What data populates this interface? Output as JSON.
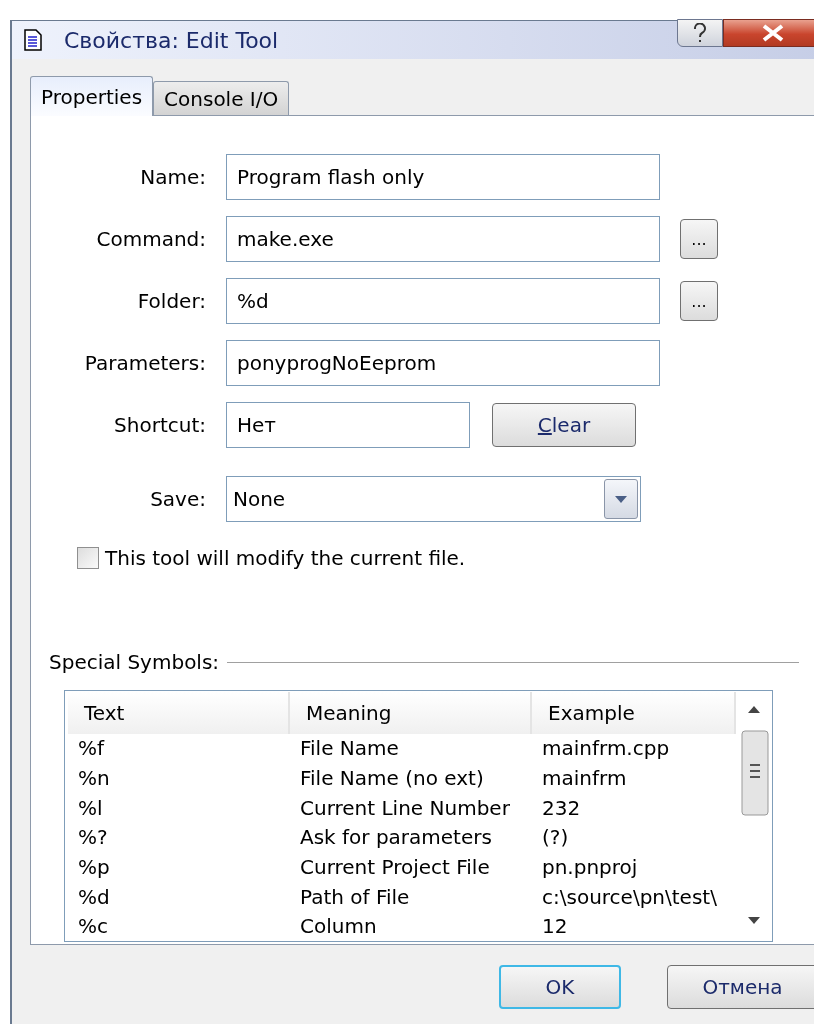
{
  "window": {
    "title": "Свойства: Edit Tool"
  },
  "tabs": [
    {
      "label": "Properties",
      "selected": true
    },
    {
      "label": "Console I/O",
      "selected": false
    }
  ],
  "fields": [
    {
      "kind": "text",
      "label": "Name:",
      "value": "Program flash only"
    },
    {
      "kind": "browse",
      "label": "Command:",
      "value": "make.exe",
      "button": "..."
    },
    {
      "kind": "browse",
      "label": "Folder:",
      "value": "%d",
      "button": "..."
    },
    {
      "kind": "text",
      "label": "Parameters:",
      "value": "ponyprogNoEeprom"
    },
    {
      "kind": "shortcut",
      "label": "Shortcut:",
      "value": "Нет",
      "button": "Clear"
    },
    {
      "kind": "select",
      "label": "Save:",
      "value": "None"
    }
  ],
  "modify_checkbox": {
    "label": "This tool will modify the current file.",
    "checked": false
  },
  "special_symbols": {
    "title": "Special Symbols:",
    "columns": [
      "Text",
      "Meaning",
      "Example"
    ],
    "rows": [
      [
        "%f",
        "File Name",
        "mainfrm.cpp"
      ],
      [
        "%n",
        "File Name (no ext)",
        "mainfrm"
      ],
      [
        "%l",
        "Current Line Number",
        "232"
      ],
      [
        "%?",
        "Ask for parameters",
        "(?)"
      ],
      [
        "%p",
        "Current Project File",
        "pn.pnproj"
      ],
      [
        "%d",
        "Path of File",
        "c:\\source\\pn\\test\\"
      ],
      [
        "%c",
        "Column",
        "12"
      ]
    ]
  },
  "buttons": [
    {
      "label": "OK",
      "default": true
    },
    {
      "label": "Отмена",
      "default": false
    }
  ]
}
